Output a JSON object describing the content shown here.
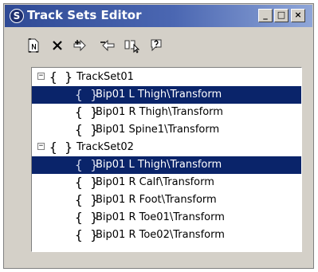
{
  "window": {
    "title": "Track Sets Editor",
    "app_icon": "S",
    "controls": {
      "minimize": "_",
      "maximize": "□",
      "close": "×"
    }
  },
  "toolbar": {
    "icons": [
      "new-trackset-icon",
      "delete-icon",
      "add-tracks-icon",
      "remove-tracks-icon",
      "get-selection-icon",
      "help-tracks-icon"
    ]
  },
  "tree": {
    "brace_glyph": "{ }",
    "collapse_glyph": "−",
    "sets": [
      {
        "name": "TrackSet01",
        "items": [
          {
            "label": "Bip01 L Thigh\\Transform",
            "selected": true
          },
          {
            "label": "Bip01 R Thigh\\Transform",
            "selected": false
          },
          {
            "label": "Bip01 Spine1\\Transform",
            "selected": false
          }
        ]
      },
      {
        "name": "TrackSet02",
        "items": [
          {
            "label": "Bip01 L Thigh\\Transform",
            "selected": true
          },
          {
            "label": "Bip01 R Calf\\Transform",
            "selected": false
          },
          {
            "label": "Bip01 R Foot\\Transform",
            "selected": false
          },
          {
            "label": "Bip01 R Toe01\\Transform",
            "selected": false
          },
          {
            "label": "Bip01 R Toe02\\Transform",
            "selected": false
          }
        ]
      }
    ]
  },
  "colors": {
    "selection": "#0a246a",
    "title_start": "#2f4a95",
    "title_end": "#8fa6d8",
    "face": "#d4d0c8"
  }
}
